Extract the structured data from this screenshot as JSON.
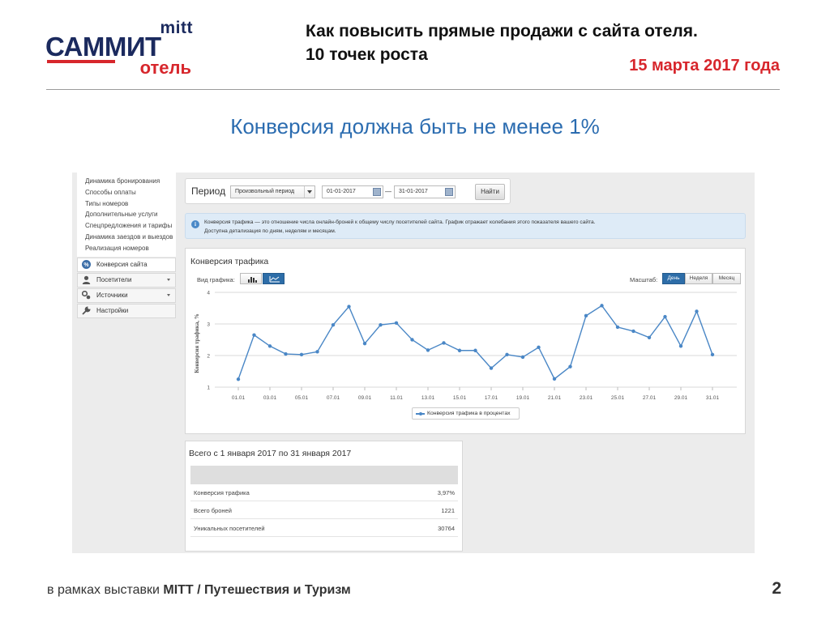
{
  "logo": {
    "mitt": "mitt",
    "summit": "САММИТ",
    "otel": "отель"
  },
  "slide": {
    "title_line1": "Как повысить прямые продажи с сайта отеля.",
    "title_line2": "10 точек роста",
    "date": "15 марта 2017 года",
    "subtitle": "Конверсия должна быть не менее 1%",
    "footer_prefix": "в рамках выставки ",
    "footer_bold": "MITT / Путешествия и Туризм",
    "page_number": "2"
  },
  "sidebar": {
    "submenu": [
      "Динамика бронирования",
      "Способы оплаты",
      "Типы номеров",
      "Дополнительные услуги",
      "Спецпредложения и тарифы",
      "Динамика заездов и выездов",
      "Реализация номеров"
    ],
    "nav": [
      {
        "label": "Конверсия сайта",
        "icon": "percent-icon",
        "active": true
      },
      {
        "label": "Посетители",
        "icon": "user-icon",
        "active": false
      },
      {
        "label": "Источники",
        "icon": "sources-icon",
        "active": false
      },
      {
        "label": "Настройки",
        "icon": "wrench-icon",
        "active": false
      }
    ]
  },
  "filter": {
    "period_label": "Период",
    "period_select": "Произвольный период",
    "date_from": "01-01-2017",
    "date_separator": "—",
    "date_to": "31-01-2017",
    "find_button": "Найти"
  },
  "info": {
    "line1": "Конверсия трафика — это отношение числа онлайн-броней к общему числу посетителей сайта. График отражает колебания этого показателя вашего сайта.",
    "line2": "Доступна детализация по дням, неделям и месяцам."
  },
  "chart_panel": {
    "title": "Конверсия трафика",
    "view_type_label": "Вид графика:",
    "scale_label": "Масштаб:",
    "scale_buttons": [
      "День",
      "Неделя",
      "Месяц"
    ],
    "active_scale": "День",
    "active_view": "line"
  },
  "chart_data": {
    "type": "line",
    "title": "Конверсия трафика",
    "xlabel": "",
    "ylabel": "Конверсия трафика, %",
    "ylim": [
      1,
      4
    ],
    "yticks": [
      "1",
      "2",
      "3",
      "4"
    ],
    "xtick_labels": [
      "01.01",
      "03.01",
      "05.01",
      "07.01",
      "09.01",
      "11.01",
      "13.01",
      "15.01",
      "17.01",
      "19.01",
      "21.01",
      "23.01",
      "25.01",
      "27.01",
      "29.01",
      "31.01"
    ],
    "grid": true,
    "legend_position": "bottom-center",
    "color": "#4a87c6",
    "series": [
      {
        "name": "Конверсия трафика в процентах",
        "x": [
          "01.01",
          "02.01",
          "03.01",
          "04.01",
          "05.01",
          "06.01",
          "07.01",
          "08.01",
          "09.01",
          "10.01",
          "11.01",
          "12.01",
          "13.01",
          "14.01",
          "15.01",
          "16.01",
          "17.01",
          "18.01",
          "19.01",
          "20.01",
          "21.01",
          "22.01",
          "23.01",
          "24.01",
          "25.01",
          "26.01",
          "27.01",
          "28.01",
          "29.01",
          "30.01",
          "31.01"
        ],
        "values": [
          1.25,
          2.65,
          2.3,
          2.05,
          2.03,
          2.12,
          2.97,
          3.55,
          2.38,
          2.97,
          3.03,
          2.5,
          2.17,
          2.4,
          2.16,
          2.16,
          1.6,
          2.03,
          1.95,
          2.26,
          1.26,
          1.65,
          3.26,
          3.58,
          2.9,
          2.77,
          2.57,
          3.23,
          2.3,
          3.4,
          2.03
        ]
      }
    ]
  },
  "summary": {
    "title": "Всего с 1 января 2017 по 31 января 2017",
    "rows": [
      {
        "label": "Конверсия трафика",
        "value": "3,97%"
      },
      {
        "label": "Всего броней",
        "value": "1221"
      },
      {
        "label": "Уникальных посетителей",
        "value": "30764"
      }
    ]
  }
}
